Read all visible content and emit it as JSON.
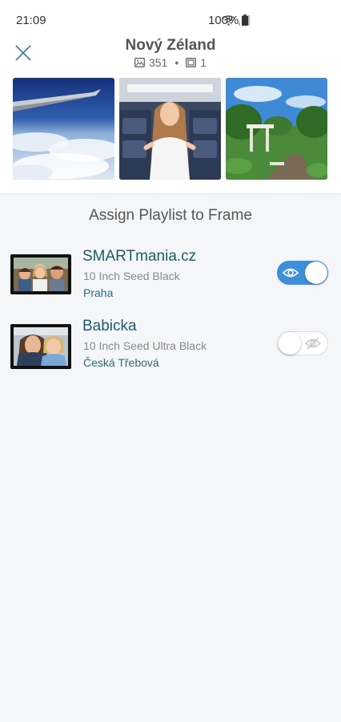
{
  "status_bar": {
    "time": "21:09",
    "battery": "100%"
  },
  "header": {
    "title": "Nový Zéland",
    "photo_count": "351",
    "frame_count": "1",
    "separator": "•"
  },
  "section": {
    "title": "Assign Playlist to Frame"
  },
  "frames": [
    {
      "name": "SMARTmania.cz",
      "model": "10 Inch Seed Black",
      "location": "Praha",
      "assigned": true
    },
    {
      "name": "Babicka",
      "model": "10 Inch Seed Ultra Black",
      "location": "Česká Třebová",
      "assigned": false
    }
  ],
  "colors": {
    "accent": "#3d8fd8",
    "frame_name": "#1f5a6a",
    "location": "#2a6b7a"
  }
}
